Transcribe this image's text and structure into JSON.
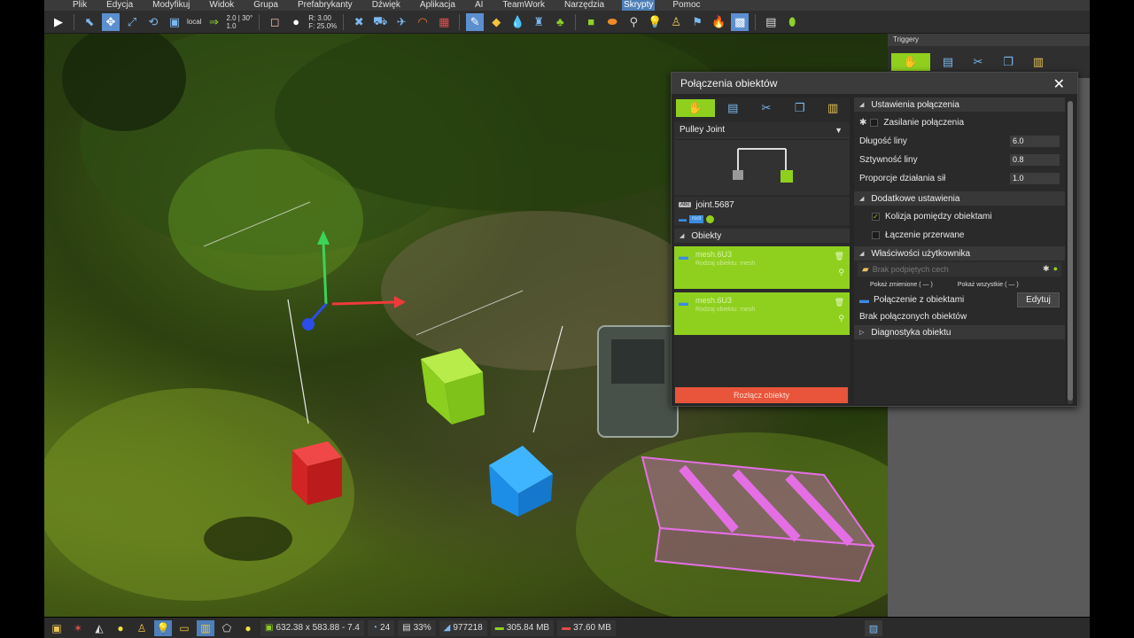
{
  "menu": {
    "items": [
      "Plik",
      "Edycja",
      "Modyfikuj",
      "Widok",
      "Grupa",
      "Prefabrykanty",
      "Dźwięk",
      "Aplikacja",
      "AI",
      "TeamWork",
      "Narzędzia",
      "Skrypty",
      "Pomoc"
    ],
    "active_index": 11
  },
  "toolbar": {
    "coord_space": "local",
    "snap_value": "2.0 | 30°",
    "snap_scale": "1.0",
    "rotate_value": "R: 3.00",
    "falloff_value": "F: 25.0%"
  },
  "side_panel": {
    "header": "Triggery"
  },
  "dialog": {
    "title": "Połączenia obiektów",
    "close_label": "✕",
    "joint_type": "Pulley Joint",
    "joint_name": "joint.5687",
    "abc_label": "Abc",
    "tag_label": "root",
    "objects_section": "Obiekty",
    "objects": [
      {
        "name": "mesh.6U3",
        "desc": "Rodzaj obiektu: mesh"
      },
      {
        "name": "mesh.6U3",
        "desc": "Rodzaj obiektu: mesh"
      }
    ],
    "disconnect_label": "Rozłącz obiekty",
    "settings_section": "Ustawienia połączenia",
    "power_label": "Zasilanie połączenia",
    "rope_length_label": "Długość liny",
    "rope_length_value": "6.0",
    "rope_stiffness_label": "Sztywność liny",
    "rope_stiffness_value": "0.8",
    "force_ratio_label": "Proporcje działania sił",
    "force_ratio_value": "1.0",
    "extra_section": "Dodatkowe ustawienia",
    "collision_label": "Kolizja pomiędzy obiektami",
    "collision_checked": true,
    "broken_label": "Łączenie przerwane",
    "broken_checked": false,
    "user_props_section": "Właściwości użytkownika",
    "traits_placeholder": "Brak podpiętych cech",
    "show_changed_label": "Pokaż zmienione ( — )",
    "show_all_label": "Pokaż wszystkie ( — )",
    "connect_label": "Połączenie z obiektami",
    "edit_label": "Edytuj",
    "no_connections_label": "Brak połączonych obiektów",
    "diagnostics_section": "Diagnostyka obiektu"
  },
  "status": {
    "dimensions": "632.38 x 583.88 - 7.4",
    "fps": "24",
    "cpu": "33%",
    "triangles": "977218",
    "memory_1": "305.84 MB",
    "memory_2": "37.60 MB"
  },
  "colors": {
    "accent_green": "#8fd01f",
    "accent_blue": "#4e7fb8",
    "danger": "#e8553a"
  }
}
